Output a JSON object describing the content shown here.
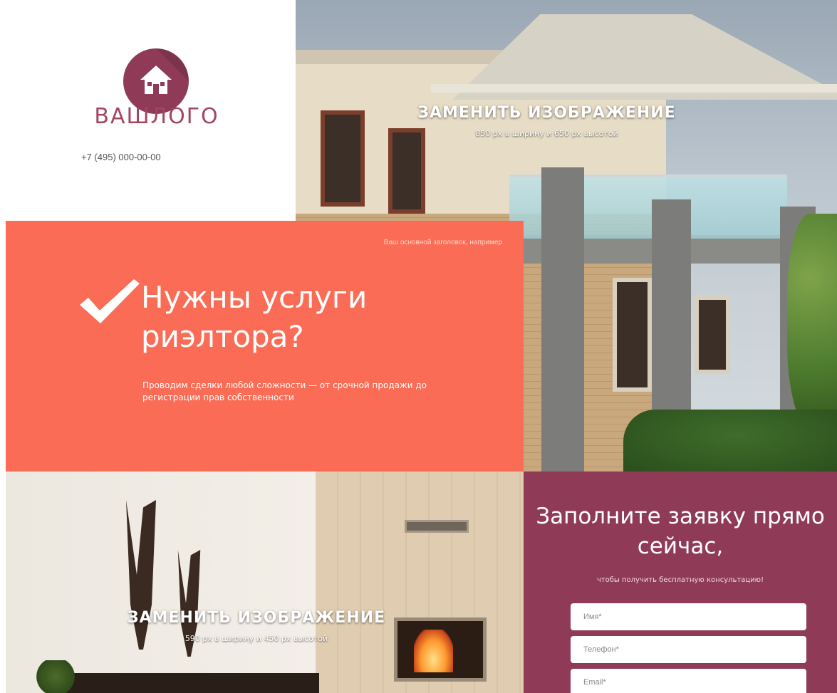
{
  "logo": {
    "text": "ВАШЛОГО",
    "icon": "house-icon",
    "circle_color": "#8f3b57"
  },
  "contact": {
    "phone": "+7 (495) 000-00-00"
  },
  "hero": {
    "placeholder_title": "ЗАМЕНИТЬ ИЗОБРАЖЕНИЕ",
    "placeholder_size": "850 px в ширину и 650 px высотой"
  },
  "offer": {
    "note": "Ваш основной заголовок, например",
    "icon": "checkmark-icon",
    "title": "Нужны услуги риэлтора?",
    "description": "Проводим сделки любой сложности — от срочной продажи до регистрации прав собственности",
    "background_color": "#fa6c55"
  },
  "interior": {
    "placeholder_title": "ЗАМЕНИТЬ ИЗОБРАЖЕНИЕ",
    "placeholder_size": "590 px в ширину и 450 px высотой"
  },
  "request_form": {
    "title": "Заполните заявку прямо сейчас,",
    "subtitle": "чтобы получить бесплатную консультацию!",
    "background_color": "#8f3b57",
    "fields": {
      "name_placeholder": "Имя*",
      "phone_placeholder": "Телефон*",
      "email_placeholder": "Email*"
    }
  }
}
